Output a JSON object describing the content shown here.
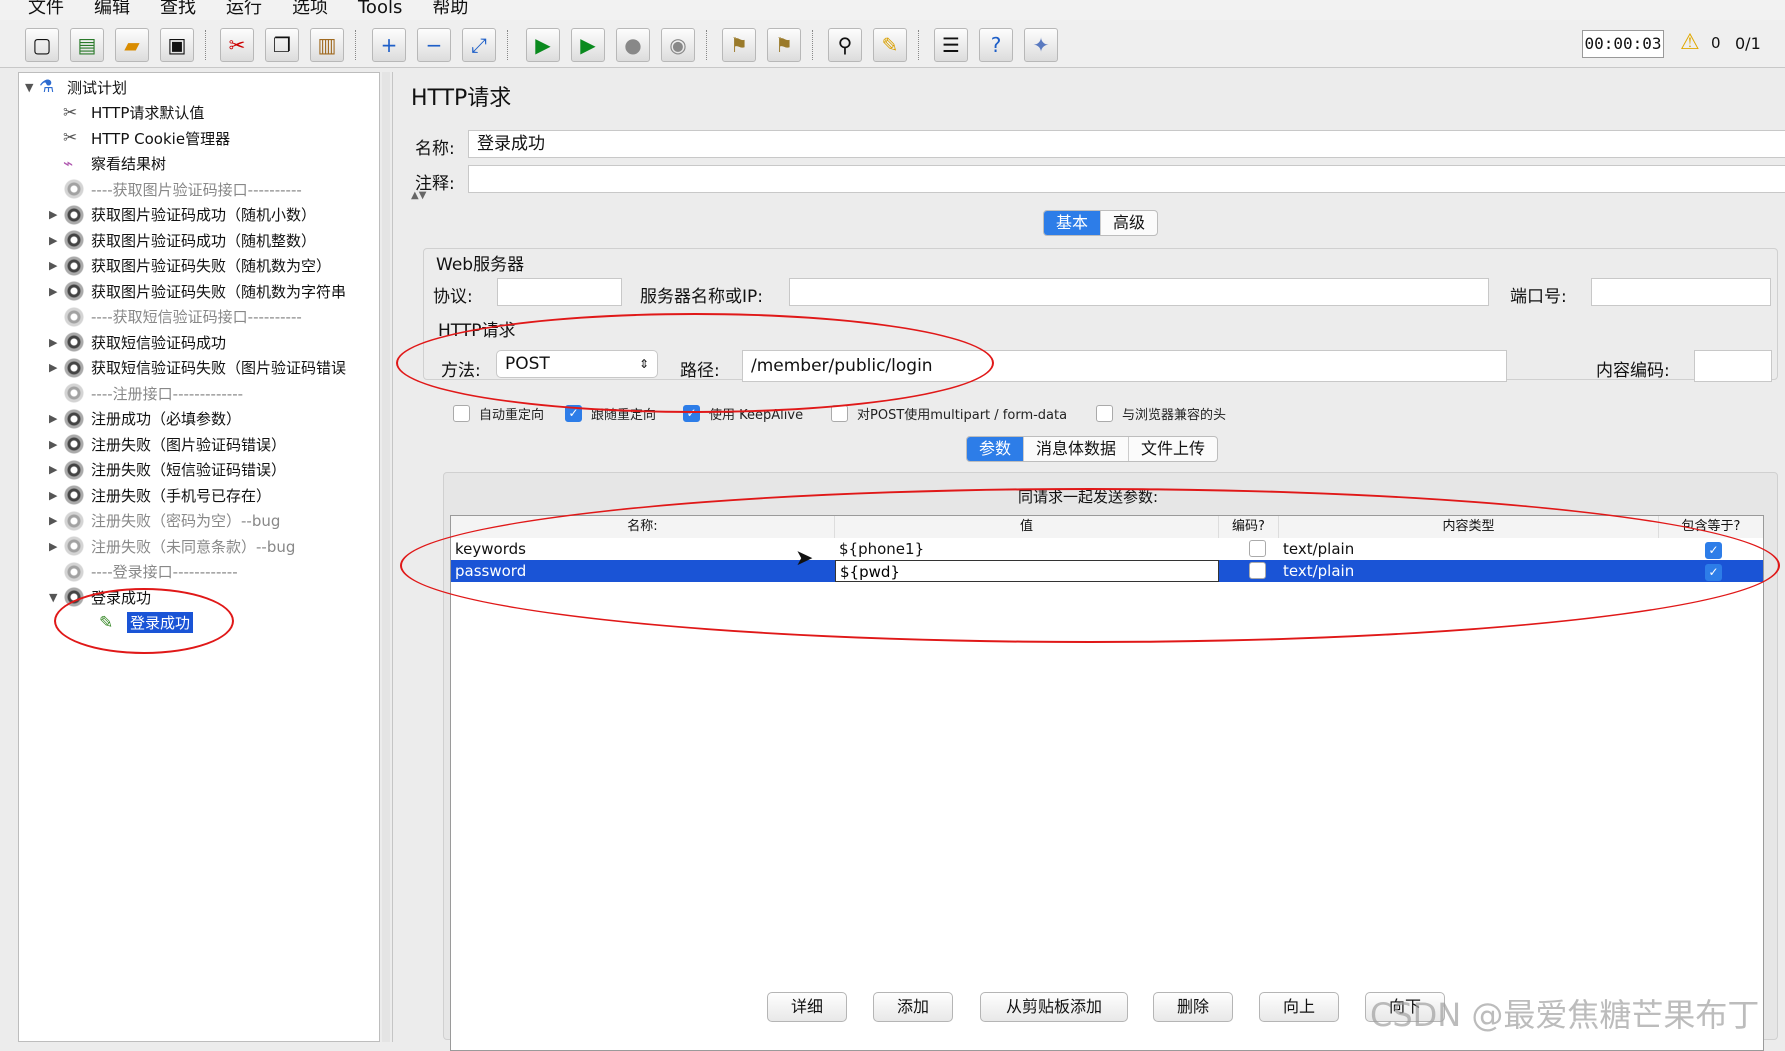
{
  "menubar": {
    "items": [
      "文件",
      "编辑",
      "查找",
      "运行",
      "选项",
      "Tools",
      "帮助"
    ]
  },
  "toolbar": {
    "timer": "00:00:03",
    "warnings": "0",
    "threads": "0/1"
  },
  "tree": {
    "root": "测试计划",
    "items": [
      {
        "label": "HTTP请求默认值",
        "icon": "wrench-scissors-icon"
      },
      {
        "label": "HTTP Cookie管理器",
        "icon": "wrench-scissors-icon"
      },
      {
        "label": "察看结果树",
        "icon": "graph-icon"
      },
      {
        "label": "----获取图片验证码接口----------",
        "icon": "gear-icon",
        "disabled": true
      },
      {
        "label": "获取图片验证码成功（随机小数）",
        "icon": "gear-icon"
      },
      {
        "label": "获取图片验证码成功（随机整数）",
        "icon": "gear-icon"
      },
      {
        "label": "获取图片验证码失败（随机数为空）",
        "icon": "gear-icon"
      },
      {
        "label": "获取图片验证码失败（随机数为字符串",
        "icon": "gear-icon"
      },
      {
        "label": "----获取短信验证码接口----------",
        "icon": "gear-icon",
        "disabled": true
      },
      {
        "label": "获取短信验证码成功",
        "icon": "gear-icon"
      },
      {
        "label": "获取短信验证码失败（图片验证码错误",
        "icon": "gear-icon"
      },
      {
        "label": "----注册接口-------------",
        "icon": "gear-icon",
        "disabled": true
      },
      {
        "label": "注册成功（必填参数）",
        "icon": "gear-icon"
      },
      {
        "label": "注册失败（图片验证码错误）",
        "icon": "gear-icon"
      },
      {
        "label": "注册失败（短信验证码错误）",
        "icon": "gear-icon"
      },
      {
        "label": "注册失败（手机号已存在）",
        "icon": "gear-icon"
      },
      {
        "label": "注册失败（密码为空）--bug",
        "icon": "gear-icon",
        "disabled": true
      },
      {
        "label": "注册失败（未同意条款）--bug",
        "icon": "gear-icon",
        "disabled": true
      },
      {
        "label": "----登录接口------------",
        "icon": "gear-icon",
        "disabled": true
      },
      {
        "label": "登录成功",
        "icon": "gear-icon"
      },
      {
        "label": "登录成功",
        "icon": "pipette-icon",
        "selected": true
      }
    ]
  },
  "panel": {
    "title": "HTTP请求",
    "name_label": "名称:",
    "name_value": "登录成功",
    "comment_label": "注释:",
    "comment_value": "",
    "tabs": [
      "基本",
      "高级"
    ],
    "web_server": {
      "legend": "Web服务器",
      "protocol_label": "协议:",
      "protocol_value": "",
      "server_label": "服务器名称或IP:",
      "server_value": "",
      "port_label": "端口号:",
      "port_value": ""
    },
    "http_request": {
      "legend": "HTTP请求",
      "method_label": "方法:",
      "method_value": "POST",
      "path_label": "路径:",
      "path_value": "/member/public/login",
      "encoding_label": "内容编码:",
      "encoding_value": ""
    },
    "checkboxes": [
      {
        "label": "自动重定向",
        "checked": false
      },
      {
        "label": "跟随重定向",
        "checked": true
      },
      {
        "label": "使用 KeepAlive",
        "checked": true
      },
      {
        "label": "对POST使用multipart / form-data",
        "checked": false
      },
      {
        "label": "与浏览器兼容的头",
        "checked": false
      }
    ],
    "param_tabs": [
      "参数",
      "消息体数据",
      "文件上传"
    ],
    "table_caption": "同请求一起发送参数:",
    "columns": [
      "名称:",
      "值",
      "编码?",
      "内容类型",
      "包含等于?"
    ],
    "rows": [
      {
        "name": "keywords",
        "value": "${phone1}",
        "encode": false,
        "content_type": "text/plain",
        "include_equals": true
      },
      {
        "name": "password",
        "value": "${pwd}",
        "encode": false,
        "content_type": "text/plain",
        "include_equals": true
      }
    ],
    "buttons": [
      "详细",
      "添加",
      "从剪贴板添加",
      "删除",
      "向上",
      "向下"
    ]
  },
  "watermark": "CSDN @最爱焦糖芒果布丁"
}
